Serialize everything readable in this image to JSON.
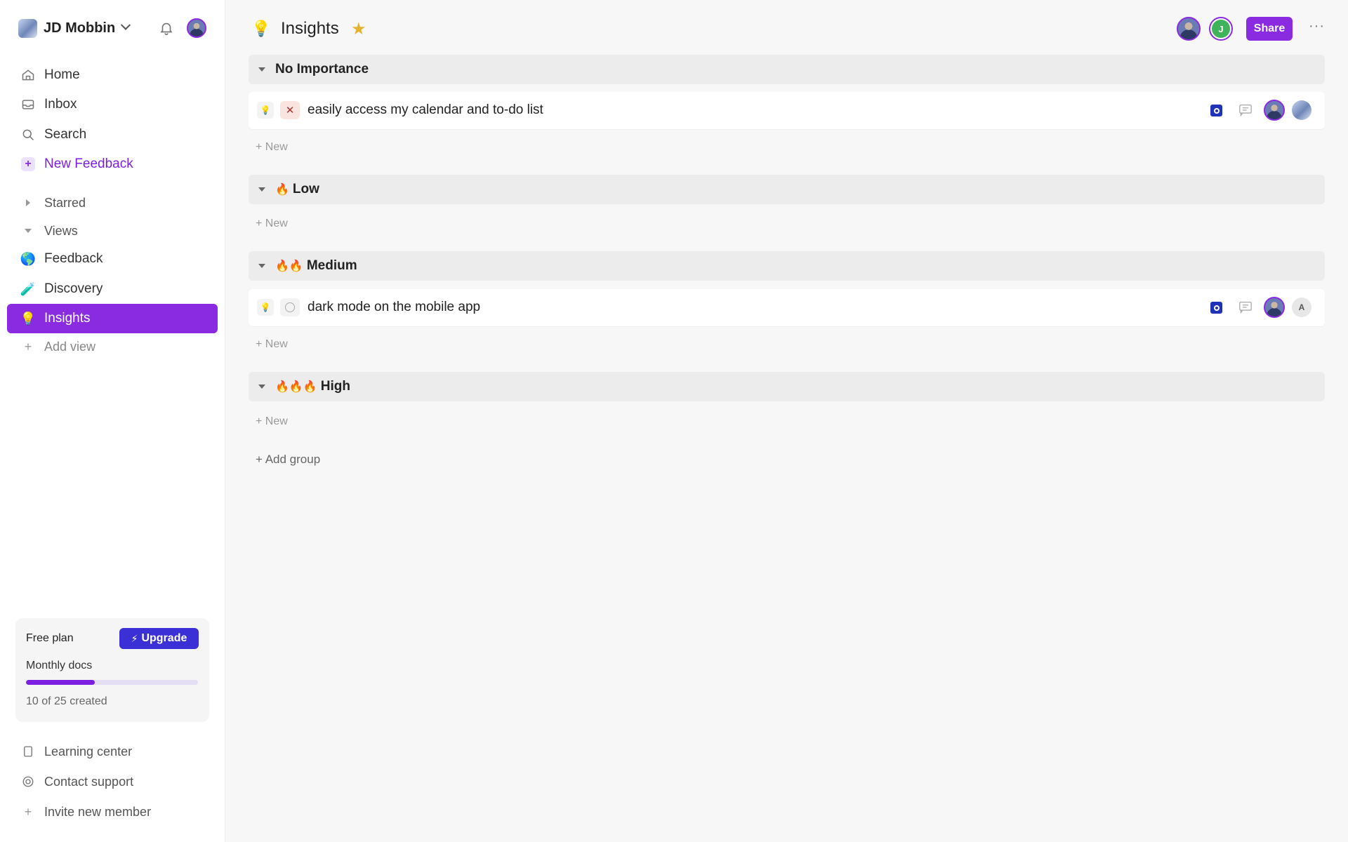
{
  "workspace": {
    "name": "JD Mobbin"
  },
  "sidebar": {
    "nav": [
      {
        "label": "Home",
        "icon": "home-icon"
      },
      {
        "label": "Inbox",
        "icon": "inbox-icon"
      },
      {
        "label": "Search",
        "icon": "search-icon"
      },
      {
        "label": "New Feedback",
        "icon": "plus-icon"
      }
    ],
    "sections": {
      "starred": "Starred",
      "views": "Views"
    },
    "views": [
      {
        "label": "Feedback",
        "emoji": "🌎"
      },
      {
        "label": "Discovery",
        "emoji": "🧪"
      },
      {
        "label": "Insights",
        "emoji": "💡"
      }
    ],
    "add_view": "Add view",
    "plan": {
      "title": "Free plan",
      "upgrade": "Upgrade",
      "metric": "Monthly docs",
      "usage_text": "10 of 25 created",
      "used": 10,
      "total": 25
    },
    "footer": [
      {
        "label": "Learning center",
        "icon": "book-icon"
      },
      {
        "label": "Contact support",
        "icon": "lifebuoy-icon"
      },
      {
        "label": "Invite new member",
        "icon": "plus-icon"
      }
    ]
  },
  "header": {
    "icon": "💡",
    "title": "Insights",
    "share": "Share",
    "more": "···",
    "member_initial": "J"
  },
  "groups": [
    {
      "name": "No Importance",
      "fires": "",
      "items": [
        {
          "title": "easily access my calendar and to-do list",
          "status": "✕",
          "assignee_initial": ""
        }
      ],
      "new_label": "+ New"
    },
    {
      "name": "Low",
      "fires": "🔥",
      "items": [],
      "new_label": "+ New"
    },
    {
      "name": "Medium",
      "fires": "🔥🔥",
      "items": [
        {
          "title": "dark mode on the mobile app",
          "status": "",
          "assignee_initial": "A"
        }
      ],
      "new_label": "+ New"
    },
    {
      "name": "High",
      "fires": "🔥🔥🔥",
      "items": [],
      "new_label": "+ New"
    }
  ],
  "add_group": "+ Add group",
  "colors": {
    "accent": "#8a2be2",
    "upgrade": "#3b2fd6",
    "star": "#e7b12c"
  }
}
